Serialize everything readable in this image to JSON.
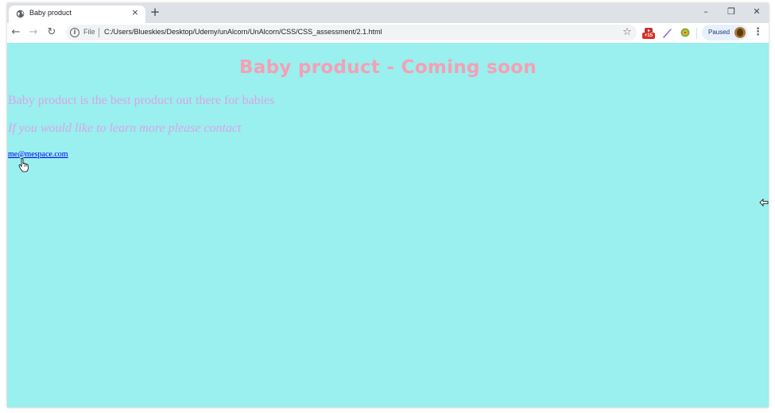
{
  "browser": {
    "tab": {
      "title": "Baby product",
      "close_glyph": "×",
      "favicon": "globe-icon"
    },
    "new_tab_glyph": "+",
    "window_controls": {
      "minimize": "–",
      "restore": "❐",
      "close": "✕"
    },
    "toolbar": {
      "back_glyph": "←",
      "forward_glyph": "→",
      "reload_glyph": "↻",
      "info_glyph": "i",
      "scheme_label": "File",
      "url": "C:/Users/Blueskies/Desktop/Udemy/unAlcorn/UnAlcorn/CSS/CSS_assessment/2.1.html",
      "star_glyph": "☆",
      "extension_badge": "+15",
      "profile_label": "Paused",
      "menu_glyph": "⋮"
    }
  },
  "page": {
    "heading": "Baby product - Coming soon",
    "paragraph1": "Baby product is the best product out there for babies",
    "paragraph2": "If you would like to learn more please contact",
    "link_text": "me@mespace.com"
  },
  "colors": {
    "page_background": "#9aefef",
    "heading": "#f5a0b4",
    "paragraph": "#d9a6e6",
    "link": "#0000ee",
    "tabstrip": "#dee1e6"
  }
}
